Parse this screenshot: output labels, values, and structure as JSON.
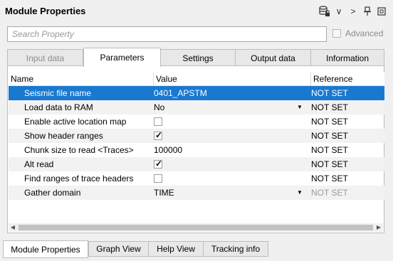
{
  "window": {
    "title": "Module Properties"
  },
  "toolbar": {
    "chevron_down": "∨",
    "chevron_right": ">",
    "pin": "⥑",
    "restore": "⧉"
  },
  "search": {
    "placeholder": "Search Property",
    "value": ""
  },
  "advanced": {
    "label": "Advanced",
    "checked": false
  },
  "tabs": [
    {
      "label": "Input data",
      "state": "disabled"
    },
    {
      "label": "Parameters",
      "state": "active"
    },
    {
      "label": "Settings",
      "state": "normal"
    },
    {
      "label": "Output data",
      "state": "normal"
    },
    {
      "label": "Information",
      "state": "normal"
    }
  ],
  "grid": {
    "columns": [
      "Name",
      "Value",
      "Reference"
    ],
    "rows": [
      {
        "name": "Seismic file name",
        "value": "0401_APSTM",
        "reference": "NOT SET",
        "selected": true
      },
      {
        "name": "Load data to RAM",
        "value": "No",
        "reference": "NOT SET",
        "dropdown": true
      },
      {
        "name": "Enable active location map",
        "value": "",
        "reference": "NOT SET",
        "checkbox": false
      },
      {
        "name": "Show header ranges",
        "value": "",
        "reference": "NOT SET",
        "checkbox": true
      },
      {
        "name": "Chunk size to read <Traces>",
        "value": "100000",
        "reference": "NOT SET"
      },
      {
        "name": "Alt read",
        "value": "",
        "reference": "NOT SET",
        "checkbox": true
      },
      {
        "name": "Find ranges of trace headers",
        "value": "",
        "reference": "NOT SET",
        "checkbox": false
      },
      {
        "name": "Gather domain",
        "value": "TIME",
        "reference": "NOT SET",
        "dropdown": true,
        "reference_dim": true
      }
    ]
  },
  "bottom_tabs": [
    {
      "label": "Module Properties",
      "active": true
    },
    {
      "label": "Graph View",
      "active": false
    },
    {
      "label": "Help View",
      "active": false
    },
    {
      "label": "Tracking info",
      "active": false
    }
  ],
  "glyphs": {
    "dropdown": "▼",
    "check": "✓",
    "left": "◀",
    "right": "▶"
  }
}
